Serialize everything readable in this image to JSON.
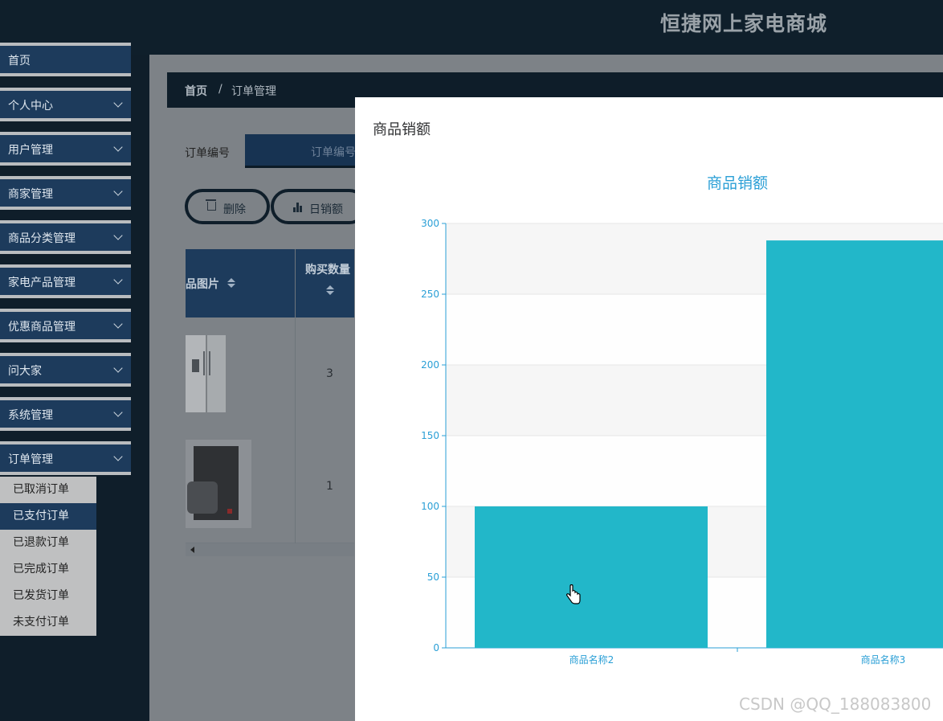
{
  "header": {
    "site_title": "恒捷网上家电商城"
  },
  "sidebar": {
    "items": [
      {
        "label": "首页",
        "chevron": false
      },
      {
        "label": "个人中心",
        "chevron": true
      },
      {
        "label": "用户管理",
        "chevron": true
      },
      {
        "label": "商家管理",
        "chevron": true
      },
      {
        "label": "商品分类管理",
        "chevron": true
      },
      {
        "label": "家电产品管理",
        "chevron": true
      },
      {
        "label": "优惠商品管理",
        "chevron": true
      },
      {
        "label": "问大家",
        "chevron": true
      },
      {
        "label": "系统管理",
        "chevron": true
      },
      {
        "label": "订单管理",
        "chevron": true
      }
    ],
    "submenu": [
      "已取消订单",
      "已支付订单",
      "已退款订单",
      "已完成订单",
      "已发货订单",
      "未支付订单"
    ],
    "submenu_active": "已支付订单"
  },
  "breadcrumb": {
    "home": "首页",
    "sep": "/",
    "current": "订单管理"
  },
  "filter": {
    "label": "订单编号",
    "placeholder": "订单编号"
  },
  "toolbar": {
    "delete_label": "删除",
    "daily_sales_label": "日销额"
  },
  "table": {
    "headers": [
      "品图片",
      "购买数量"
    ],
    "rows": [
      {
        "quantity": "3",
        "image": "refrigerator"
      },
      {
        "quantity": "1",
        "image": "coffee-maker"
      }
    ]
  },
  "modal": {
    "title": "商品销额"
  },
  "chart_data": {
    "type": "bar",
    "title": "商品销额",
    "categories": [
      "商品名称2",
      "商品名称3"
    ],
    "values": [
      100,
      288
    ],
    "ylim": [
      0,
      300
    ],
    "yticks": [
      0,
      50,
      100,
      150,
      200,
      250,
      300
    ],
    "grid": true,
    "color": "#22b7c9"
  },
  "watermark": "CSDN @QQ_188083800"
}
